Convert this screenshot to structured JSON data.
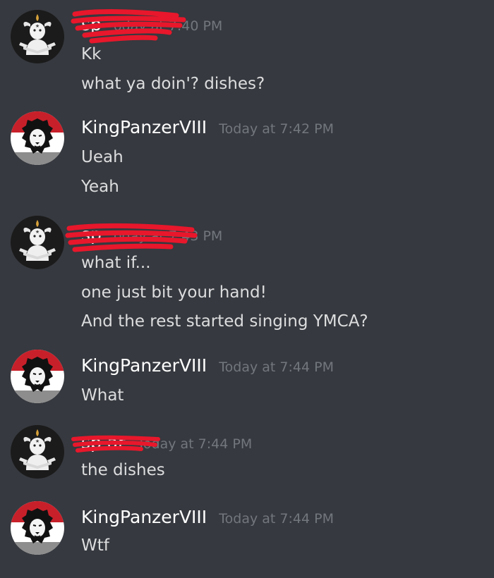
{
  "colors": {
    "background": "#36393f",
    "username": "#ffffff",
    "timestamp": "#72767d",
    "message_text": "#dcddde",
    "redaction": "#e8172b"
  },
  "groups": [
    {
      "avatar": "goat-avatar-icon",
      "username": "sp",
      "timestamp": "oday at 7:40 PM",
      "messages": [
        "Kk",
        "what ya doin'? dishes?"
      ]
    },
    {
      "avatar": "lion-avatar-icon",
      "username": "KingPanzerVIII",
      "timestamp": "Today at 7:42 PM",
      "messages": [
        "Ueah",
        "Yeah"
      ]
    },
    {
      "avatar": "goat-avatar-icon",
      "username": "sp",
      "timestamp": "oday at 7:43 PM",
      "messages": [
        "what if...",
        "one just bit your hand!",
        "And the rest started singing YMCA?"
      ]
    },
    {
      "avatar": "lion-avatar-icon",
      "username": "KingPanzerVIII",
      "timestamp": "Today at 7:44 PM",
      "messages": [
        "What"
      ]
    },
    {
      "avatar": "goat-avatar-icon",
      "username": "sp       ar",
      "timestamp": "Today at 7:44 PM",
      "messages": [
        "the dishes"
      ]
    },
    {
      "avatar": "lion-avatar-icon",
      "username": "KingPanzerVIII",
      "timestamp": "Today at 7:44 PM",
      "messages": [
        "Wtf"
      ]
    }
  ]
}
